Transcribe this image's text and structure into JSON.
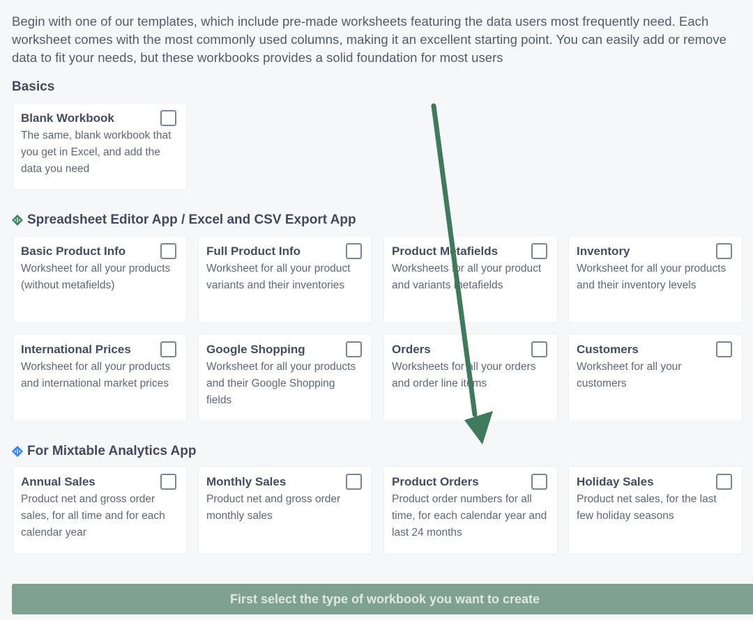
{
  "intro_text": "Begin with one of our templates, which include pre-made worksheets featuring the data users most frequently need. Each worksheet comes with the most commonly used columns, making it an excellent starting point. You can easily add or remove data to fit your needs, but these workbooks provides a solid foundation for most users",
  "sections": [
    {
      "title": "Basics",
      "icon": null,
      "cards": [
        {
          "title": "Blank Workbook",
          "description": "The same, blank workbook that you get in Excel, and add the data you need",
          "checked": false
        }
      ]
    },
    {
      "title": "Spreadsheet Editor App / Excel and CSV Export App",
      "icon": "spreadsheet-app-diamond-icon",
      "icon_color": "#3f7f5c",
      "cards": [
        {
          "title": "Basic Product Info",
          "description": "Worksheet for all your products (without metafields)",
          "checked": false
        },
        {
          "title": "Full Product Info",
          "description": "Worksheet for all your product variants and their inventories",
          "checked": false
        },
        {
          "title": "Product Metafields",
          "description": "Worksheets for all your product and variants metafields",
          "checked": false
        },
        {
          "title": "Inventory",
          "description": "Worksheet for all your products and their inventory levels",
          "checked": false
        },
        {
          "title": "International Prices",
          "description": "Worksheet for all your products and international market prices",
          "checked": false
        },
        {
          "title": "Google Shopping",
          "description": "Worksheet for all your products and their Google Shopping fields",
          "checked": false
        },
        {
          "title": "Orders",
          "description": "Worksheets for all your orders and order line items",
          "checked": false
        },
        {
          "title": "Customers",
          "description": "Worksheet for all your customers",
          "checked": false
        }
      ]
    },
    {
      "title": "For Mixtable Analytics App",
      "icon": "analytics-app-diamond-icon",
      "icon_color": "#2f80ed",
      "cards": [
        {
          "title": "Annual Sales",
          "description": "Product net and gross order sales, for all time and for each calendar year",
          "checked": false
        },
        {
          "title": "Monthly Sales",
          "description": "Product net and gross order monthly sales",
          "checked": false
        },
        {
          "title": "Product Orders",
          "description": "Product order numbers for all time, for each calendar year and last 24 months",
          "checked": false
        },
        {
          "title": "Holiday Sales",
          "description": "Product net sales, for the last few holiday seasons",
          "checked": false
        }
      ]
    }
  ],
  "create_button": {
    "label": "First select the type of workbook you want to create",
    "disabled": true
  },
  "annotation": {
    "type": "arrow",
    "color": "#3f7a5c",
    "points_to": "Product Orders"
  }
}
